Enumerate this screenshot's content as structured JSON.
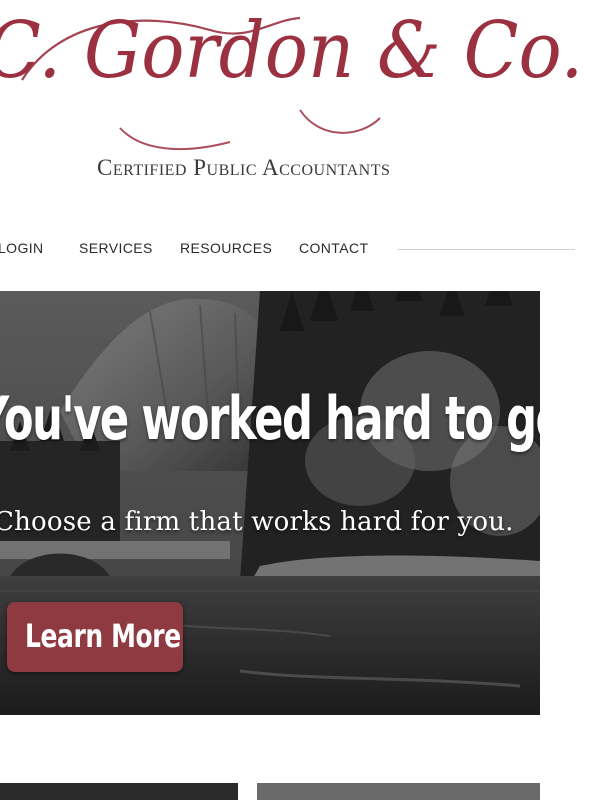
{
  "logo": {
    "script_text": "C. Gordon & Co.",
    "tagline": "Certified Public Accountants",
    "brand_color": "#9b3040"
  },
  "nav": {
    "items": [
      {
        "label": "LOGIN"
      },
      {
        "label": "SERVICES"
      },
      {
        "label": "RESOURCES"
      },
      {
        "label": "CONTACT"
      }
    ]
  },
  "hero": {
    "headline": "You've worked hard to get where you are.",
    "subheadline": "Choose a firm that works hard for you.",
    "button_label": "Learn More",
    "button_color": "#8e3a40"
  }
}
